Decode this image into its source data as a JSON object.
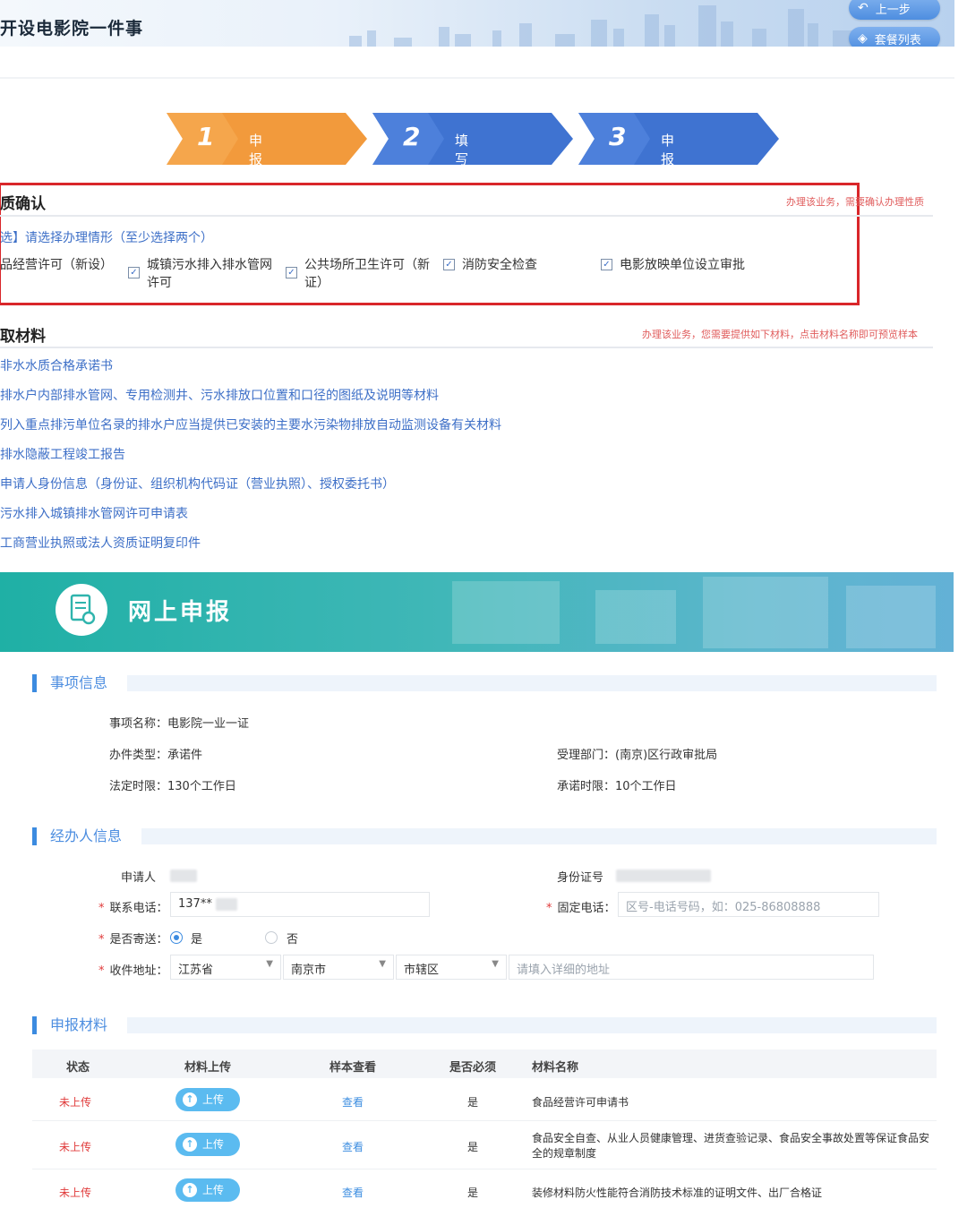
{
  "header": {
    "title": "开设电影院一件事",
    "prev_button": "上一步",
    "list_button": "套餐列表"
  },
  "steps": [
    {
      "num": "1",
      "label": "申报须知",
      "color": "#f29a3c"
    },
    {
      "num": "2",
      "label": "填写套餐表单",
      "color": "#3f73d1"
    },
    {
      "num": "3",
      "label": "申报告知",
      "color": "#3f73d1"
    }
  ],
  "confirm": {
    "heading": "质确认",
    "note": "办理该业务，需要确认办理性质",
    "choose_label": "选】请选择办理情形（至少选择两个）",
    "options": [
      {
        "label": "品经营许可（新设）",
        "checked": false
      },
      {
        "label": "城镇污水排入排水管网许可",
        "checked": true
      },
      {
        "label": "公共场所卫生许可（新证）",
        "checked": true
      },
      {
        "label": "消防安全检查",
        "checked": true
      },
      {
        "label": "电影放映单位设立审批",
        "checked": true
      }
    ]
  },
  "materials": {
    "heading": "取材料",
    "note": "办理该业务，您需要提供如下材料，点击材料名称即可预览样本",
    "items": [
      "非水水质合格承诺书",
      "排水户内部排水管网、专用检测井、污水排放口位置和口径的图纸及说明等材料",
      "列入重点排污单位名录的排水户应当提供已安装的主要水污染物排放自动监测设备有关材料",
      "排水隐蔽工程竣工报告",
      "申请人身份信息（身份证、组织机构代码证（营业执照）、授权委托书）",
      "污水排入城镇排水管网许可申请表",
      "工商营业执照或法人资质证明复印件"
    ]
  },
  "online": {
    "title": "网上申报"
  },
  "item_info": {
    "heading": "事项信息",
    "name_label": "事项名称：",
    "name_value": "电影院一业一证",
    "type_label": "办件类型：",
    "type_value": "承诺件",
    "dept_label": "受理部门：",
    "dept_value": "(南京)区行政审批局",
    "legal_label": "法定时限：",
    "legal_value": "130个工作日",
    "promise_label": "承诺时限：",
    "promise_value": "10个工作日"
  },
  "agent_info": {
    "heading": "经办人信息",
    "applicant_label": "申请人",
    "id_label": "身份证号",
    "phone_label": "联系电话：",
    "phone_value": "137**",
    "fixed_label": "固定电话：",
    "fixed_placeholder": "区号-电话号码，如：025-86808888",
    "mail_label": "是否寄送：",
    "mail_yes": "是",
    "mail_no": "否",
    "address_label": "收件地址：",
    "province": "江苏省",
    "city": "南京市",
    "district": "市辖区",
    "address_placeholder": "请填入详细的地址"
  },
  "declare": {
    "heading": "申报材料",
    "columns": [
      "状态",
      "材料上传",
      "样本查看",
      "是否必须",
      "材料名称"
    ],
    "upload_label": "上传",
    "rows": [
      {
        "status": "未上传",
        "view": "查看",
        "required": "是",
        "name": "食品经营许可申请书"
      },
      {
        "status": "未上传",
        "view": "查看",
        "required": "是",
        "name": "食品安全自查、从业人员健康管理、进货查验记录、食品安全事故处置等保证食品安全的规章制度"
      },
      {
        "status": "未上传",
        "view": "查看",
        "required": "是",
        "name": "装修材料防火性能符合消防技术标准的证明文件、出厂合格证"
      }
    ]
  },
  "colors": {
    "step_orange": "#f29a3c",
    "step_blue": "#3f73d1",
    "highlight_red": "#d9262a",
    "link_blue": "#3d6fc7",
    "online_teal": "#2fb4ad"
  }
}
